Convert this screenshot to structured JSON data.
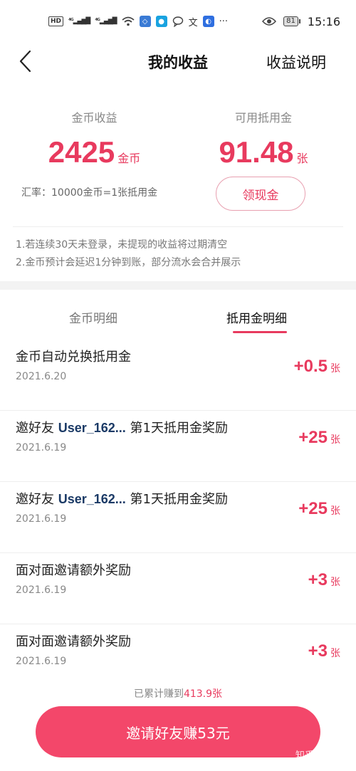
{
  "status_bar": {
    "hd": "HD",
    "net1": "⁴ᴳ",
    "net2": "⁴ᴳ",
    "battery": "81",
    "time": "15:16",
    "more": "···"
  },
  "nav": {
    "title": "我的收益",
    "help": "收益说明"
  },
  "earnings": {
    "coins_label": "金币收益",
    "coins_value": "2425",
    "coins_unit": "金币",
    "voucher_label": "可用抵用金",
    "voucher_value": "91.48",
    "voucher_unit": "张",
    "rate": "汇率：10000金币=1张抵用金",
    "withdraw_label": "领现金"
  },
  "notes": [
    "1.若连续30天未登录，未提现的收益将过期清空",
    "2.金币预计会延迟1分钟到账，部分流水会合并展示"
  ],
  "tabs": [
    {
      "label": "金币明细",
      "active": false
    },
    {
      "label": "抵用金明细",
      "active": true
    }
  ],
  "records": [
    {
      "prefix": "金币自动兑换抵用金",
      "user": "",
      "suffix": "",
      "date": "2021.6.20",
      "amount": "+0.5",
      "unit": "张"
    },
    {
      "prefix": "邀好友 ",
      "user": "User_162...",
      "suffix": " 第1天抵用金奖励",
      "date": "2021.6.19",
      "amount": "+25",
      "unit": "张"
    },
    {
      "prefix": "邀好友 ",
      "user": "User_162...",
      "suffix": " 第1天抵用金奖励",
      "date": "2021.6.19",
      "amount": "+25",
      "unit": "张"
    },
    {
      "prefix": "面对面邀请额外奖励",
      "user": "",
      "suffix": "",
      "date": "2021.6.19",
      "amount": "+3",
      "unit": "张"
    },
    {
      "prefix": "面对面邀请额外奖励",
      "user": "",
      "suffix": "",
      "date": "2021.6.19",
      "amount": "+3",
      "unit": "张"
    }
  ],
  "footer": {
    "total_prefix": "已累计赚到",
    "total_value": "413.9张",
    "invite_label": "邀请好友赚53元",
    "watermark": "知乎 @再说"
  },
  "colors": {
    "accent": "#e83a5e",
    "button": "#f3476a",
    "username": "#1b3a66"
  }
}
